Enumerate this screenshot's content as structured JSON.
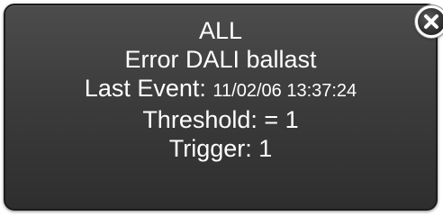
{
  "dialog": {
    "title": "ALL",
    "message": "Error DALI ballast",
    "last_event_label": "Last Event:",
    "last_event_value": "11/02/06 13:37:24",
    "threshold": "Threshold: = 1",
    "trigger": "Trigger: 1"
  },
  "close_button": {
    "icon": "close-icon"
  },
  "colors": {
    "panel": "#3c3c3c",
    "text": "#ffffff"
  }
}
